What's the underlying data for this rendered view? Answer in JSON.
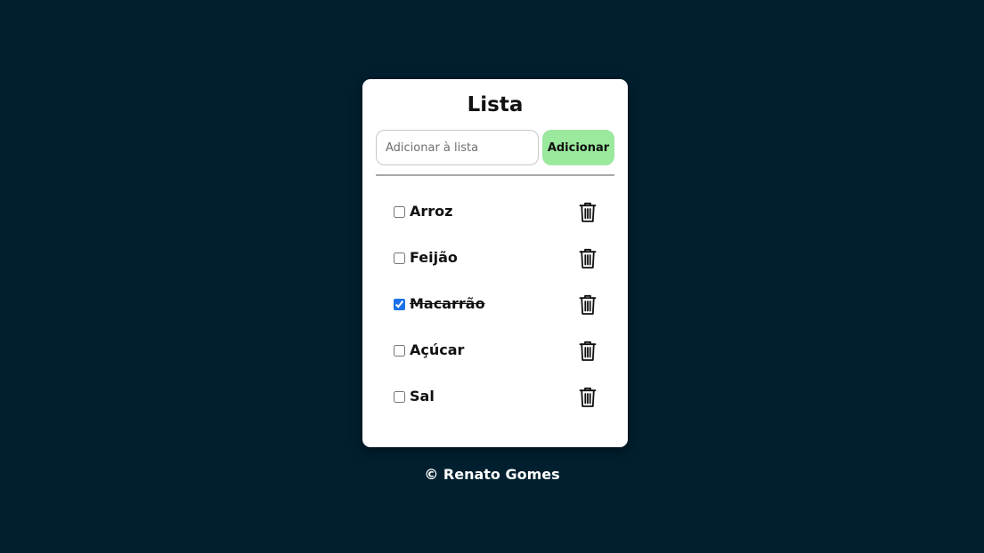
{
  "card": {
    "title": "Lista",
    "input": {
      "placeholder": "Adicionar à lista",
      "value": ""
    },
    "add_button_label": "Adicionar"
  },
  "items": [
    {
      "label": "Arroz",
      "checked": false
    },
    {
      "label": "Feijão",
      "checked": false
    },
    {
      "label": "Macarrão",
      "checked": true
    },
    {
      "label": "Açúcar",
      "checked": false
    },
    {
      "label": "Sal",
      "checked": false
    }
  ],
  "footer": {
    "text": "© Renato Gomes"
  },
  "colors": {
    "background": "#001f2f",
    "card": "#ffffff",
    "add_button": "#9ae99d",
    "checkbox_accent": "#1a73e8"
  },
  "icons": {
    "delete": "trash-icon"
  }
}
